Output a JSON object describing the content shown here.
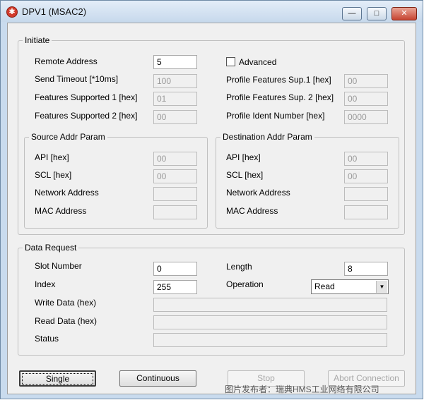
{
  "window": {
    "title": "DPV1 (MSAC2)",
    "app_icon": "hms-icon"
  },
  "caption_buttons": {
    "minimize": "—",
    "maximize": "□",
    "close": "✕"
  },
  "initiate": {
    "title": "Initiate",
    "remote_address": {
      "label": "Remote Address",
      "value": "5"
    },
    "send_timeout": {
      "label": "Send Timeout [*10ms]",
      "value": "100"
    },
    "features_supported_1": {
      "label": "Features Supported 1 [hex]",
      "value": "01"
    },
    "features_supported_2": {
      "label": "Features Supported 2 [hex]",
      "value": "00"
    },
    "advanced": {
      "label": "Advanced",
      "checked": false
    },
    "profile_features_sup_1": {
      "label": "Profile Features Sup.1 [hex]",
      "value": "00"
    },
    "profile_features_sup_2": {
      "label": "Profile Features Sup. 2 [hex]",
      "value": "00"
    },
    "profile_ident_number": {
      "label": "Profile Ident Number [hex]",
      "value": "0000"
    },
    "source": {
      "title": "Source Addr Param",
      "api": {
        "label": "API [hex]",
        "value": "00"
      },
      "scl": {
        "label": "SCL [hex]",
        "value": "00"
      },
      "network_address": {
        "label": "Network Address",
        "value": ""
      },
      "mac_address": {
        "label": "MAC Address",
        "value": ""
      }
    },
    "destination": {
      "title": "Destination Addr Param",
      "api": {
        "label": "API [hex]",
        "value": "00"
      },
      "scl": {
        "label": "SCL [hex]",
        "value": "00"
      },
      "network_address": {
        "label": "Network Address",
        "value": ""
      },
      "mac_address": {
        "label": "MAC Address",
        "value": ""
      }
    }
  },
  "data_request": {
    "title": "Data Request",
    "slot_number": {
      "label": "Slot Number",
      "value": "0"
    },
    "index": {
      "label": "Index",
      "value": "255"
    },
    "length": {
      "label": "Length",
      "value": "8"
    },
    "operation": {
      "label": "Operation",
      "selected": "Read"
    },
    "write_data": {
      "label": "Write Data (hex)",
      "value": ""
    },
    "read_data": {
      "label": "Read Data (hex)",
      "value": ""
    },
    "status": {
      "label": "Status",
      "value": ""
    }
  },
  "buttons": {
    "single": "Single",
    "continuous": "Continuous",
    "stop": "Stop",
    "abort": "Abort Connection"
  },
  "watermark": "图片发布者：瑞典HMS工业网络有限公司"
}
